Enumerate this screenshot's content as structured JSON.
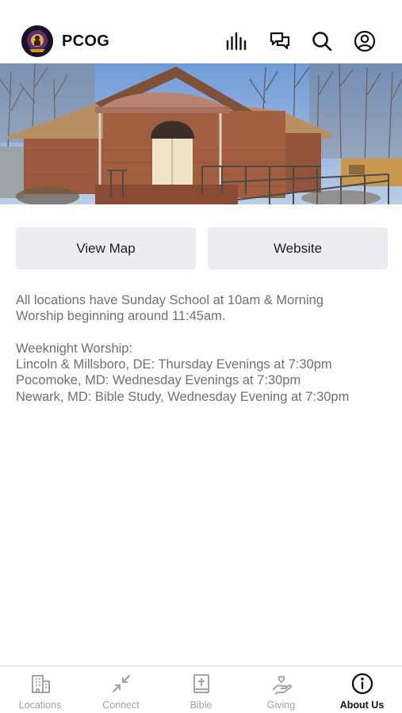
{
  "header": {
    "app_title": "PCOG",
    "icons": [
      "equalizer-icon",
      "chat-icon",
      "search-icon",
      "account-icon"
    ]
  },
  "hero": {
    "image": "church-building-photo"
  },
  "actions": {
    "view_map_label": "View Map",
    "website_label": "Website"
  },
  "info": {
    "lines": [
      "All locations have Sunday School at 10am & Morning",
      "Worship beginning around 11:45am.",
      "",
      "Weeknight Worship:",
      "Lincoln & Millsboro, DE: Thursday Evenings at 7:30pm",
      "Pocomoke, MD: Wednesday Evenings at 7:30pm",
      "Newark, MD: Bible Study, Wednesday Evening at 7:30pm"
    ]
  },
  "tabs": [
    {
      "label": "Locations",
      "icon": "building-icon",
      "active": false
    },
    {
      "label": "Connect",
      "icon": "connect-arrows-icon",
      "active": false
    },
    {
      "label": "Bible",
      "icon": "bible-icon",
      "active": false
    },
    {
      "label": "Giving",
      "icon": "giving-hand-icon",
      "active": false
    },
    {
      "label": "About Us",
      "icon": "info-icon",
      "active": true
    }
  ],
  "colors": {
    "button_bg": "#ebedf0",
    "body_text": "#707070",
    "tab_inactive": "#a3a3a3",
    "tab_active": "#111111"
  }
}
